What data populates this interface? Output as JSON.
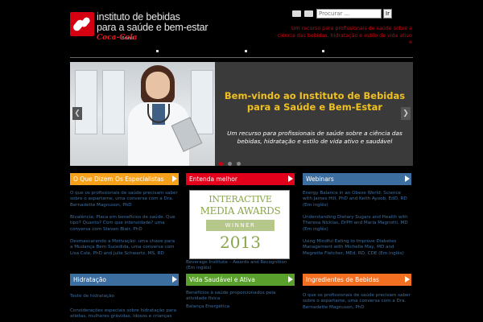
{
  "header": {
    "logo_lines": [
      "instituto de bebidas",
      "para a saúde e bem-estar"
    ],
    "brand": "Coca-Cola",
    "brand_sub": "Brasil",
    "search_placeholder": "Procurar ...",
    "search_button": "Ir",
    "tagline": "Um recurso para profissionais de saúde sobre a ciência das bebidas, hidratação e estilo de vida ativo e",
    "icons": [
      "mail-icon",
      "print-icon"
    ]
  },
  "slider": {
    "title": "Bem-vindo ao Instituto de Bebidas para a Saúde e Bem-Estar",
    "text": "Um recurso para profissionais de saúde sobre a ciência das bebidas, hidratação e estilo de vida ativo e saudável",
    "prev": "❮",
    "next": "❯",
    "slides_count": 3,
    "active_slide": 1
  },
  "columns_top": [
    {
      "heading": "O Que Dizem Os Especialistas",
      "color": "#f7a11a",
      "items": [
        "O que os profissionais de saúde precisam saber sobre o aspartame, uma conversa com a Dra. Bernadette Magnuson, PhD",
        "Bivalência: Placa em benefícios de saúde. Que tipo? Quanto? Com que intensidade? uma conversa com Steven Blair, PhD",
        "Desmascarando a Motivação: uma chave para a Mudança Bem Sucedida, uma conversa com Lisa Cole, PhD and Julie Schwartz, MS, RD"
      ]
    },
    {
      "heading": "Entenda melhor",
      "color": "#e2001a",
      "award": {
        "line1": "INTERACTIVE",
        "line2": "MEDIA AWARDS",
        "band": "WINNER",
        "year": "2013"
      },
      "caption": "Beverage Institute – Awards and Recognition (Em inglês)"
    },
    {
      "heading": "Webinars",
      "color": "#3d6ea0",
      "items": [
        "Energy Balance in an Obese World: Science with James Hill, PhD and Keith Ayoob, EdD, RD (Em inglês)",
        "Understanding Dietary Sugars and Health with Theresa Nicklas, DrPH and Maria Magnotti, MD (Em inglês)",
        "Using Mindful Eating to Improve Diabetes Management with Michelle May, MD and Megrette Fletcher, MEd, RD, CDE (Em inglês)"
      ]
    }
  ],
  "columns_bottom": [
    {
      "heading": "Hidratação",
      "color": "#3d6ea0",
      "items": [
        "Teste de hidratação",
        "Considerações especiais sobre hidratação para atletas, mulheres grávidas, idosos e crianças"
      ]
    },
    {
      "heading": "Vida Saudável e Ativa",
      "color": "#5aa02c",
      "items": [
        "Benefícios à saúde proporcionados pela atividade física",
        "Balança Energética"
      ]
    },
    {
      "heading": "Ingredientes de Bebidas",
      "color": "#f36f21",
      "items": [
        "O que os profissionais de saúde precisam saber sobre o aspartame, uma conversa com a Dra. Bernadette Magnuson, PhD"
      ]
    }
  ]
}
